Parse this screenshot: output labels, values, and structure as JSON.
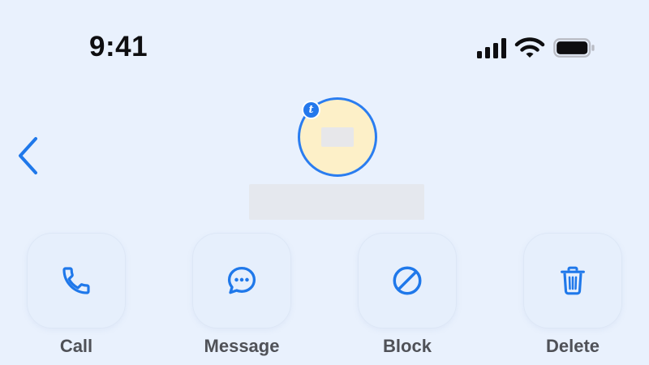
{
  "status_bar": {
    "time": "9:41",
    "icons": [
      "cellular-signal-icon",
      "wifi-icon",
      "battery-icon"
    ]
  },
  "navigation": {
    "back_icon": "chevron-left-icon"
  },
  "contact": {
    "initials": "",
    "name": "",
    "badge_letter": "t",
    "avatar_background": "#fdf0c8",
    "avatar_border": "#2a7df0"
  },
  "actions": [
    {
      "label": "Call",
      "icon": "phone-icon"
    },
    {
      "label": "Message",
      "icon": "chat-bubble-icon"
    },
    {
      "label": "Block",
      "icon": "block-icon"
    },
    {
      "label": "Delete",
      "icon": "trash-icon"
    }
  ],
  "colors": {
    "background": "#e9f1fd",
    "accent": "#1f78ea",
    "label_text": "#4f5157"
  }
}
